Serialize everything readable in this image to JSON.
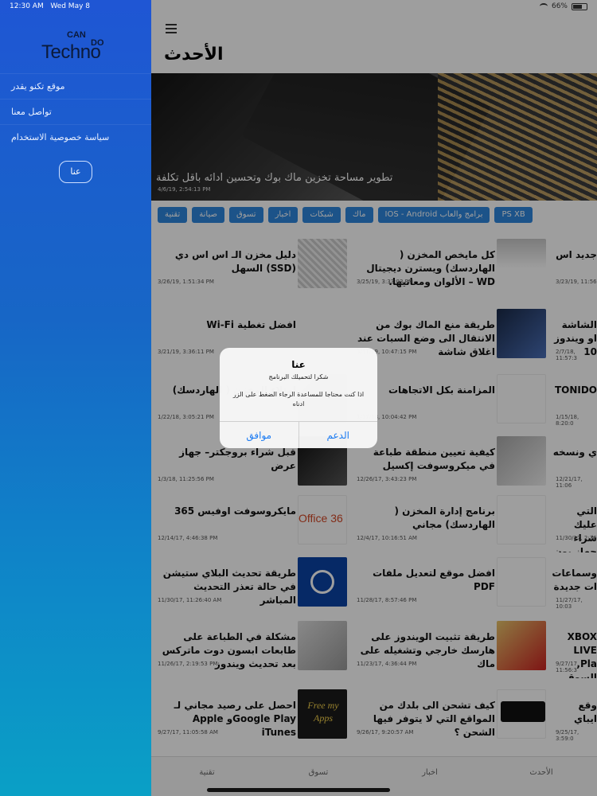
{
  "status": {
    "time": "12:30 AM",
    "date": "Wed May 8",
    "battery": "66%"
  },
  "sidebar": {
    "logo": {
      "can": "CAN",
      "do": "DO",
      "techno": "Techno"
    },
    "items": [
      {
        "label": "موقع تكنو يقدر"
      },
      {
        "label": "تواصل معنا"
      },
      {
        "label": "سياسة خصوصية الاستخدام"
      }
    ],
    "about_button": "عنا"
  },
  "main": {
    "title": "الأحدث",
    "hero": {
      "caption": "تطوير مساحة تخزين ماك بوك وتحسين ادائه باقل تكلفة",
      "date": "4/6/19, 2:54:13 PM"
    },
    "chips": [
      "تقنية",
      "صيانة",
      "تسوق",
      "اخبار",
      "شبكات",
      "ماك",
      "برامج والعاب IOS - Android",
      "PS XB"
    ],
    "articles": [
      {
        "title": "دليل مخزن الـ اس اس دي (SSD) السهل",
        "date": "3/26/19, 1:51:34 PM"
      },
      {
        "title": "كل مايخص المخزن ( الهاردسك) ويسترن ديجيتال WD – الألوان ومعانيها.",
        "date": "3/25/19, 3:33:03 PM"
      },
      {
        "title": "جديد اس",
        "date": "3/23/19, 11:56"
      },
      {
        "title": "افضل تغطية Wi-Fi",
        "date": "3/21/19, 3:36:11 PM"
      },
      {
        "title": "طريقة منع الماك بوك من الانتقال الى وضع السبات عند اغلاق شاشة",
        "date": "3/11/19, 10:47:15 PM"
      },
      {
        "title": "الشاشة او ويندوز 10",
        "date": "2/7/18, 11:57:3"
      },
      {
        "title": "امتلاء المخزن ( الهاردسك)",
        "date": "1/22/18, 3:05:21 PM"
      },
      {
        "title": "المزامنة بكل الاتجاهات",
        "date": "1/17/18, 10:04:42 PM"
      },
      {
        "title": "TONIDO",
        "date": "1/15/18, 8:20:0"
      },
      {
        "title": "قبل شراء بروجكتر– جهاز عرض",
        "date": "1/3/18, 11:25:56 PM"
      },
      {
        "title": "كيفية تعيين منطقة طباعة في ميكروسوفت إكسيل",
        "date": "12/26/17, 3:43:23 PM"
      },
      {
        "title": "ي ونسخه",
        "date": "12/21/17, 11:06"
      },
      {
        "title": "مايكروسوفت اوفيس 365",
        "date": "12/14/17, 4:46:38 PM"
      },
      {
        "title": "برنامج إدارة المخزن ( الهاردسك) مجاني",
        "date": "12/4/17, 10:16:51 AM"
      },
      {
        "title": "التي عليك شراء جهاز يون جديد",
        "date": "11/30/17, 2:36"
      },
      {
        "title": "طريقة تحديث البلاي ستيشن في حالة تعذر التحديث المباشر",
        "date": "11/30/17, 11:26:40 AM"
      },
      {
        "title": "افضل موقع لتعديل ملفات PDF",
        "date": "11/28/17, 8:57:46 PM"
      },
      {
        "title": "وسماعات ات جديدة",
        "date": "11/27/17, 10:03"
      },
      {
        "title": "مشكلة في الطباعة على طابعات ابسون دوت ماترکس بعد تحديث ويندوز",
        "date": "11/26/17, 2:19:53 PM"
      },
      {
        "title": "طريقة تثبيت الويندوز على هارسك خارجي وتشغيله على ماك",
        "date": "11/23/17, 4:36:44 PM"
      },
      {
        "title": "XBOX LIVE ,Pla السوق",
        "date": "9/27/17, 11:56:3"
      },
      {
        "title": "احصل على رصيد مجاني لـ Google Playو Apple iTunes",
        "date": "9/27/17, 11:05:58 AM"
      },
      {
        "title": "كيف تشحن الى بلدك من المواقع التي لا يتوفر فيها الشحن ؟",
        "date": "9/26/17, 9:20:57 AM"
      },
      {
        "title": "وقع ايباي",
        "date": "9/25/17, 3:59:0"
      }
    ],
    "thumb_texts": {
      "office": "Office 36",
      "free_apps": "Free my Apps"
    },
    "tabs": [
      "تقنية",
      "تسوق",
      "اخبار",
      "الأحدث"
    ]
  },
  "alert": {
    "title": "عنا",
    "subtitle": "شكرا لتحميلك البرنامج",
    "message": "اذا كنت محتاجا للمساعدة الرجاء الضغط على الزر ادناه",
    "buttons": {
      "support": "الدعم",
      "ok": "موافق"
    }
  }
}
